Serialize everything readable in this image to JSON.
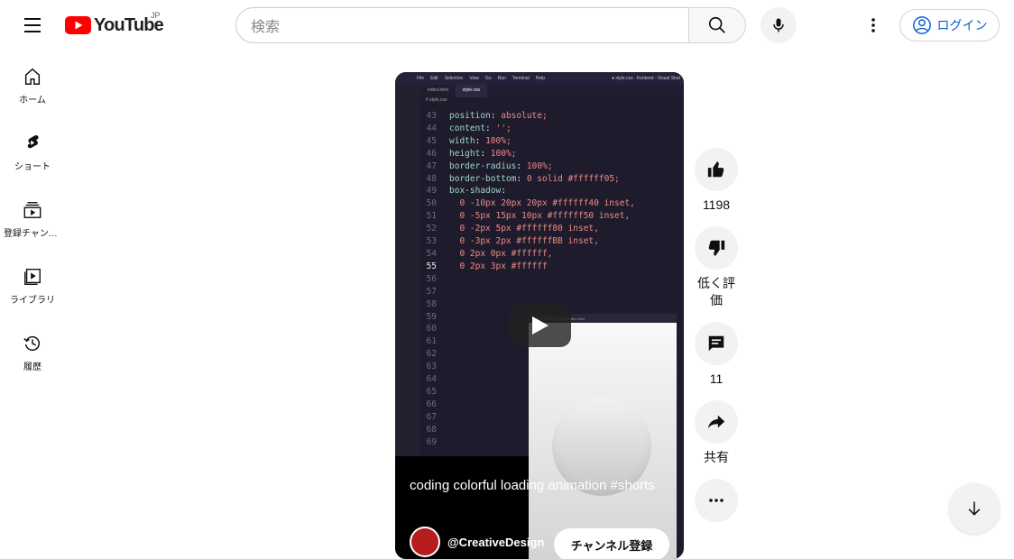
{
  "header": {
    "logo_text": "YouTube",
    "country_code": "JP",
    "search_placeholder": "検索",
    "login_label": "ログイン"
  },
  "guide": {
    "items": [
      {
        "label": "ホーム",
        "icon": "home-icon"
      },
      {
        "label": "ショート",
        "icon": "shorts-icon"
      },
      {
        "label": "登録チャンネル",
        "icon": "subscriptions-icon"
      },
      {
        "label": "ライブラリ",
        "icon": "library-icon"
      },
      {
        "label": "履歴",
        "icon": "history-icon"
      }
    ]
  },
  "editor": {
    "menu": [
      "File",
      "Edit",
      "Selection",
      "View",
      "Go",
      "Run",
      "Terminal",
      "Help"
    ],
    "window_title": "● style.css - frontend - Visual Stud",
    "tabs": [
      "index.html",
      "style.css"
    ],
    "breadcrumb": "# style.css",
    "preview_url": "http://127.0.0.1:5500/index.html",
    "lines": [
      {
        "n": "43",
        "code": "position: absolute;"
      },
      {
        "n": "44",
        "code": "content: '';"
      },
      {
        "n": "45",
        "code": "width: 100%;"
      },
      {
        "n": "46",
        "code": "height: 100%;"
      },
      {
        "n": "47",
        "code": "border-radius: 100%;"
      },
      {
        "n": "48",
        "code": "border-bottom: 0 solid #ffffff05;"
      },
      {
        "n": "49",
        "code": "box-shadow:"
      },
      {
        "n": "50",
        "code": "  0 -10px 20px 20px #ffffff40 inset,"
      },
      {
        "n": "51",
        "code": "  0 -5px 15px 10px #ffffff50 inset,"
      },
      {
        "n": "52",
        "code": "  0 -2px 5px #ffffff80 inset,"
      },
      {
        "n": "53",
        "code": "  0 -3px 2px #ffffffBB inset,"
      },
      {
        "n": "54",
        "code": "  0 2px 0px #ffffff,"
      },
      {
        "n": "55",
        "code": "  0 2px 3px #ffffff"
      },
      {
        "n": "56",
        "code": ""
      },
      {
        "n": "57",
        "code": ""
      },
      {
        "n": "58",
        "code": ""
      },
      {
        "n": "59",
        "code": ""
      },
      {
        "n": "60",
        "code": ""
      },
      {
        "n": "61",
        "code": ""
      },
      {
        "n": "62",
        "code": ""
      },
      {
        "n": "63",
        "code": ""
      },
      {
        "n": "64",
        "code": ""
      },
      {
        "n": "65",
        "code": ""
      },
      {
        "n": "66",
        "code": ""
      },
      {
        "n": "67",
        "code": ""
      },
      {
        "n": "68",
        "code": ""
      },
      {
        "n": "69",
        "code": ""
      }
    ]
  },
  "video": {
    "title": "coding colorful loading animation #shorts",
    "channel_name": "@CreativeDesign",
    "subscribe_label": "チャンネル登録"
  },
  "actions": {
    "like_count": "1198",
    "dislike_label": "低く評価",
    "comment_count": "11",
    "share_label": "共有"
  },
  "colors": {
    "brand_red": "#ff0000",
    "link_blue": "#065fd4"
  }
}
